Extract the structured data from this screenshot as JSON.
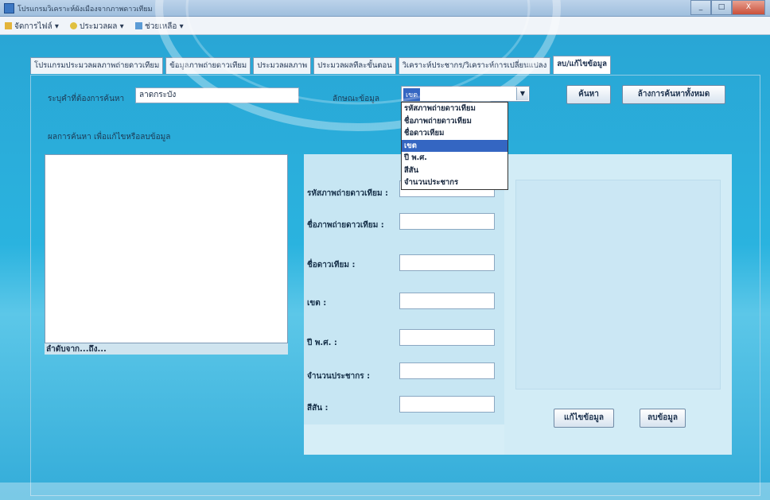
{
  "window": {
    "title": "โปรแกรมวิเคราะห์ผังเมืองจากภาพดาวเทียม",
    "buttons": [
      "_",
      "□",
      "X"
    ]
  },
  "menu": [
    {
      "label": "จัดการไฟล์",
      "icon": "folder-icon"
    },
    {
      "label": "ประมวลผล",
      "icon": "process-icon"
    },
    {
      "label": "ช่วยเหลือ",
      "icon": "help-icon"
    }
  ],
  "tabs": [
    "โปรแกรมประมวลผลภาพถ่ายดาวเทียม",
    "ข้อมูลภาพถ่ายดาวเทียม",
    "ประมวลผลภาพ",
    "ประมวลผลทีละขั้นตอน",
    "วิเคราะห์ประชากร/วิเคราะห์การเปลี่ยนแปลง",
    "ลบ/แก้ไขข้อมูล"
  ],
  "search": {
    "keyword_label": "ระบุคำที่ต้องการค้นหา",
    "keyword_value": "ลาดกระบัง",
    "category_label": "ลักษณะข้อมูล",
    "category_selected": "เขต",
    "category_options": [
      "รหัสภาพถ่ายดาวเทียม",
      "ชื่อภาพถ่ายดาวเทียม",
      "ชื่อดาวเทียม",
      "เขต",
      "ปี พ.ศ.",
      "สีสัน",
      "จำนวนประชากร"
    ],
    "search_button": "ค้นหา",
    "clear_button": "ล้างการค้นหาทั้งหมด",
    "results_label": "ผลการค้นหา เพื่อแก้ไขหรือลบข้อมูล",
    "status_text": "ลำดับจาก...ถึง..."
  },
  "form": {
    "fields": [
      "รหัสภาพถ่ายดาวเทียม :",
      "ชื่อภาพถ่ายดาวเทียม :",
      "ชื่อดาวเทียม :",
      "เขต :",
      "ปี พ.ศ. :",
      "จำนวนประชากร :",
      "สีสัน :"
    ],
    "edit_button": "แก้ไขข้อมูล",
    "delete_button": "ลบข้อมูล"
  }
}
